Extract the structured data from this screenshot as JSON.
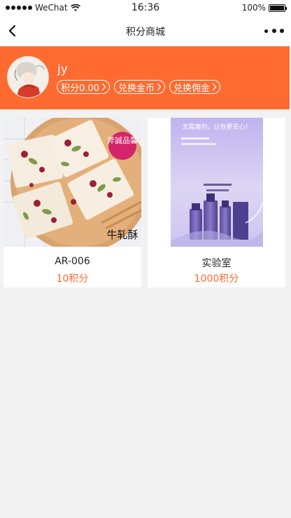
{
  "status_bar": {
    "carrier": "WeChat",
    "time": "16:36",
    "battery": "100%"
  },
  "navbar": {
    "title": "积分商城"
  },
  "profile": {
    "username": "jy",
    "chips": [
      {
        "label": "积分0.00"
      },
      {
        "label": "兑换金币"
      },
      {
        "label": "兑换佣金"
      }
    ]
  },
  "products": [
    {
      "name": "AR-006",
      "price": "10积分",
      "image_text_stamp": "斧誠品馨",
      "image_text_caption": "牛轧酥"
    },
    {
      "name": "实验室",
      "price": "1000积分",
      "image_text_headline": "无需魔剂，让你更安心！"
    }
  ],
  "colors": {
    "accent": "#ff6a30",
    "background": "#f2f2f2"
  }
}
